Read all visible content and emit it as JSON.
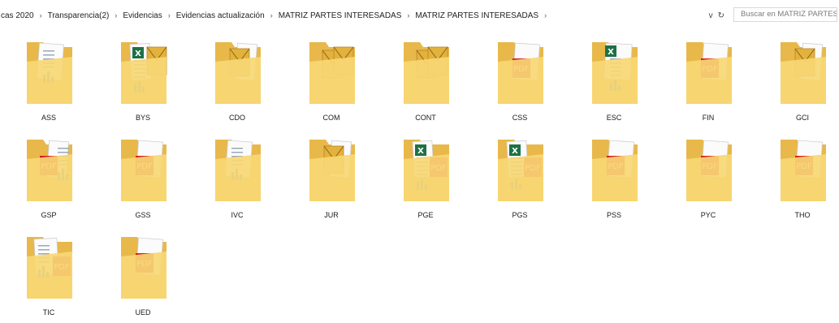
{
  "address": {
    "crumbs": [
      "cas 2020",
      "Transparencia(2)",
      "Evidencias",
      "Evidencias actualización",
      "MATRIZ PARTES INTERESADAS",
      "MATRIZ PARTES INTERESADAS"
    ],
    "separator": "›",
    "dropdown_glyph": "v",
    "refresh_glyph": "↻"
  },
  "search": {
    "placeholder": "Buscar en MATRIZ PARTES INT..."
  },
  "folders": [
    {
      "name": "ASS",
      "preview": "doc-chart"
    },
    {
      "name": "BYS",
      "preview": "excel-mail"
    },
    {
      "name": "CDO",
      "preview": "mail"
    },
    {
      "name": "COM",
      "preview": "mail2"
    },
    {
      "name": "CONT",
      "preview": "mail2"
    },
    {
      "name": "CSS",
      "preview": "pdf"
    },
    {
      "name": "ESC",
      "preview": "excel"
    },
    {
      "name": "FIN",
      "preview": "pdf"
    },
    {
      "name": "GCI",
      "preview": "mail"
    },
    {
      "name": "GSP",
      "preview": "pdf-doc"
    },
    {
      "name": "GSS",
      "preview": "pdf"
    },
    {
      "name": "IVC",
      "preview": "doc-chart"
    },
    {
      "name": "JUR",
      "preview": "mail"
    },
    {
      "name": "PGE",
      "preview": "excel-pdf"
    },
    {
      "name": "PGS",
      "preview": "excel-pdf"
    },
    {
      "name": "PSS",
      "preview": "pdf"
    },
    {
      "name": "PYC",
      "preview": "pdf"
    },
    {
      "name": "THO",
      "preview": "pdf"
    },
    {
      "name": "TIC",
      "preview": "doc-pdf"
    },
    {
      "name": "UED",
      "preview": "pdf"
    }
  ],
  "colors": {
    "folder_back": "#e8b84a",
    "folder_front": "#f7d774",
    "pdf_red": "#d71920",
    "excel_green": "#1e7145",
    "mail_gold": "#e3b23c"
  }
}
